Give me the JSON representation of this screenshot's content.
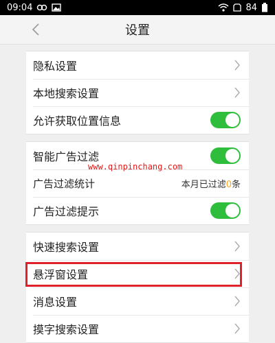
{
  "status_bar": {
    "time": "09:04",
    "battery": "84"
  },
  "header": {
    "title": "设置"
  },
  "group1": {
    "items": [
      {
        "label": "隐私设置"
      },
      {
        "label": "本地搜索设置"
      },
      {
        "label": "允许获取位置信息"
      }
    ]
  },
  "group2": {
    "items": [
      {
        "label": "智能广告过滤"
      },
      {
        "label": "广告过滤统计",
        "value_prefix": "本月已过滤",
        "value_count": "0",
        "value_suffix": "条"
      },
      {
        "label": "广告过滤提示"
      }
    ]
  },
  "group3": {
    "items": [
      {
        "label": "快速搜索设置"
      },
      {
        "label": "悬浮窗设置"
      },
      {
        "label": "消息设置"
      },
      {
        "label": "摸字搜索设置"
      }
    ]
  },
  "watermark": "www.qinpinchang.com",
  "colors": {
    "toggle_on": "#2ebe3c",
    "highlight": "#e0202a",
    "watermark": "#e21a1a",
    "count": "#f5a623"
  }
}
